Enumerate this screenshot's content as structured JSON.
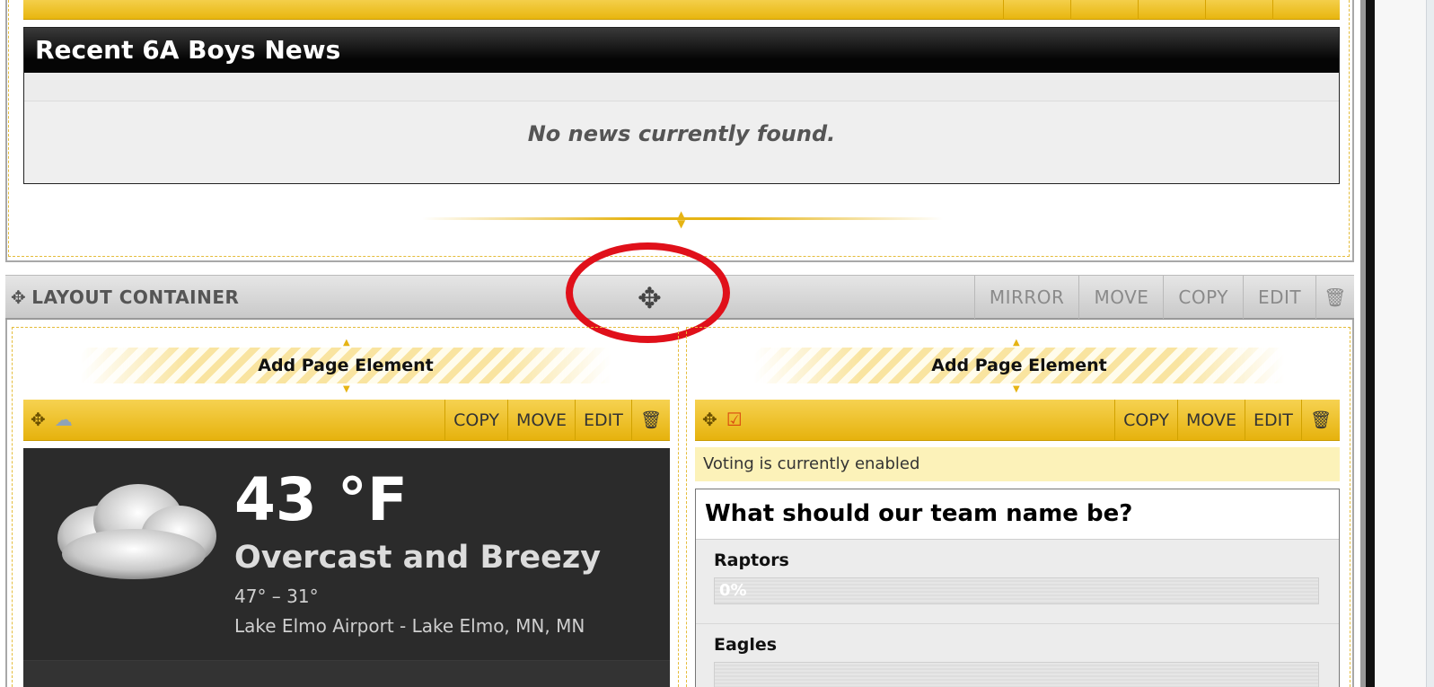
{
  "news": {
    "title": "Recent 6A Boys News",
    "empty_message": "No news currently found."
  },
  "layout_container": {
    "title": "LAYOUT CONTAINER",
    "actions": [
      "MIRROR",
      "MOVE",
      "COPY",
      "EDIT"
    ]
  },
  "add_element_label": "Add Page Element",
  "element_tools": [
    "COPY",
    "MOVE",
    "EDIT"
  ],
  "weather": {
    "temperature": "43 °F",
    "condition": "Overcast and Breezy",
    "range": "47° – 31°",
    "location": "Lake Elmo Airport - Lake Elmo, MN, MN"
  },
  "poll": {
    "voting_status": "Voting is currently enabled",
    "question": "What should our team name be?",
    "options": [
      {
        "name": "Raptors",
        "percent_label": "0%",
        "fraction": 0
      },
      {
        "name": "Eagles",
        "percent_label": "",
        "fraction": 0
      }
    ]
  },
  "colors": {
    "accent_gold": "#e6b414",
    "highlight_ring": "#e0101a",
    "header_black": "#050505"
  }
}
